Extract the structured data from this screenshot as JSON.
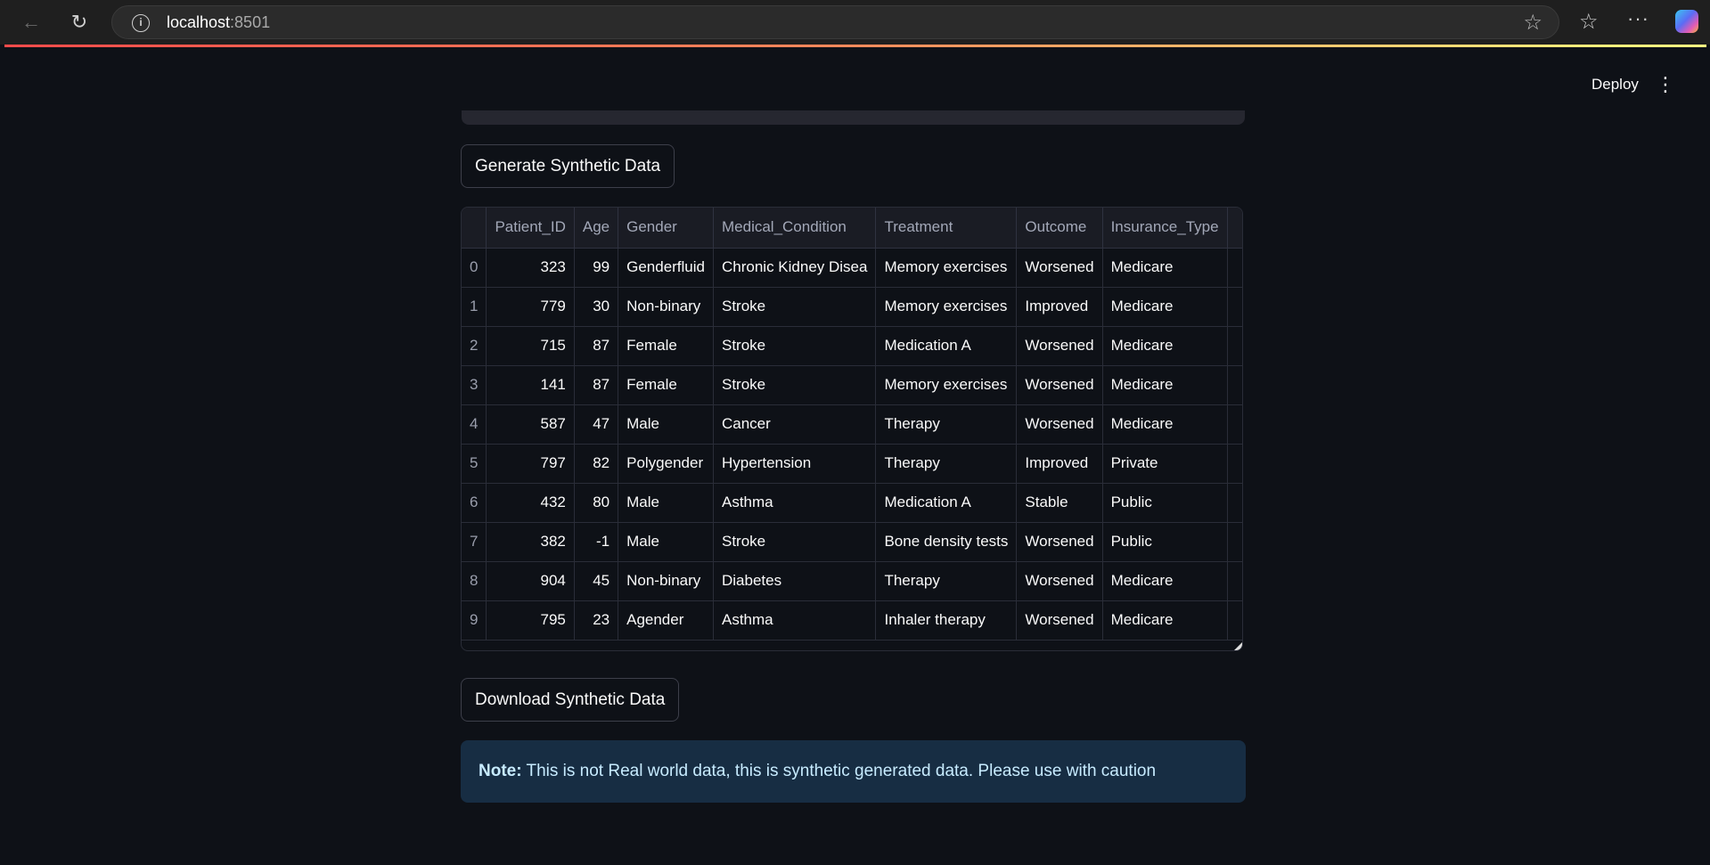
{
  "browser": {
    "url_host": "localhost",
    "url_port": ":8501"
  },
  "header": {
    "deploy_label": "Deploy"
  },
  "buttons": {
    "generate_label": "Generate Synthetic Data",
    "download_label": "Download Synthetic Data"
  },
  "table": {
    "columns": [
      "",
      "Patient_ID",
      "Age",
      "Gender",
      "Medical_Condition",
      "Treatment",
      "Outcome",
      "Insurance_Type"
    ],
    "rows": [
      [
        "0",
        "323",
        "99",
        "Genderfluid",
        "Chronic Kidney Disea",
        "Memory exercises",
        "Worsened",
        "Medicare"
      ],
      [
        "1",
        "779",
        "30",
        "Non-binary",
        "Stroke",
        "Memory exercises",
        "Improved",
        "Medicare"
      ],
      [
        "2",
        "715",
        "87",
        "Female",
        "Stroke",
        "Medication A",
        "Worsened",
        "Medicare"
      ],
      [
        "3",
        "141",
        "87",
        "Female",
        "Stroke",
        "Memory exercises",
        "Worsened",
        "Medicare"
      ],
      [
        "4",
        "587",
        "47",
        "Male",
        "Cancer",
        "Therapy",
        "Worsened",
        "Medicare"
      ],
      [
        "5",
        "797",
        "82",
        "Polygender",
        "Hypertension",
        "Therapy",
        "Improved",
        "Private"
      ],
      [
        "6",
        "432",
        "80",
        "Male",
        "Asthma",
        "Medication A",
        "Stable",
        "Public"
      ],
      [
        "7",
        "382",
        "-1",
        "Male",
        "Stroke",
        "Bone density tests",
        "Worsened",
        "Public"
      ],
      [
        "8",
        "904",
        "45",
        "Non-binary",
        "Diabetes",
        "Therapy",
        "Worsened",
        "Medicare"
      ],
      [
        "9",
        "795",
        "23",
        "Agender",
        "Asthma",
        "Inhaler therapy",
        "Worsened",
        "Medicare"
      ]
    ]
  },
  "note": {
    "prefix": "Note:",
    "text": " This is not Real world data, this is synthetic generated data. Please use with caution"
  }
}
